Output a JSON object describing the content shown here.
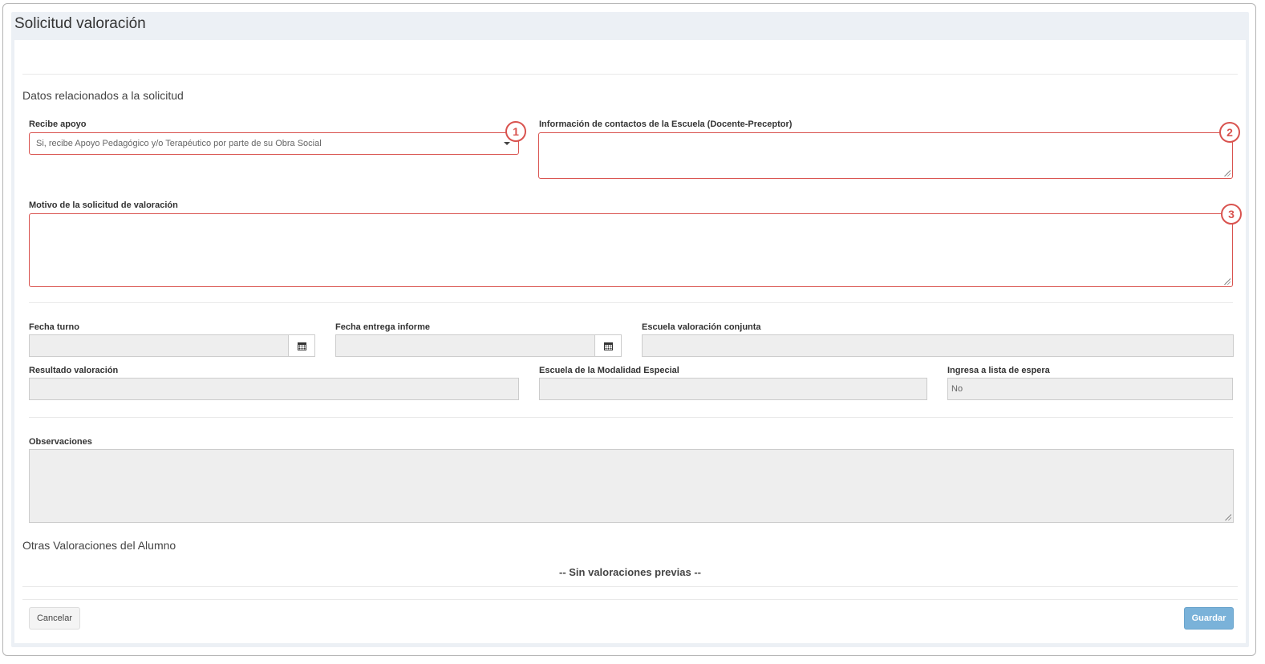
{
  "panel": {
    "title": "Solicitud valoración"
  },
  "section1": {
    "title": "Datos relacionados a la solicitud"
  },
  "fields": {
    "recibe_apoyo": {
      "label": "Recibe apoyo",
      "value": "Si, recibe Apoyo Pedagógico y/o Terapéutico por parte de su Obra Social"
    },
    "contactos": {
      "label": "Información de contactos de la Escuela (Docente-Preceptor)",
      "value": ""
    },
    "motivo": {
      "label": "Motivo de la solicitud de valoración",
      "value": ""
    },
    "fecha_turno": {
      "label": "Fecha turno",
      "value": ""
    },
    "fecha_entrega": {
      "label": "Fecha entrega informe",
      "value": ""
    },
    "escuela_conjunta": {
      "label": "Escuela valoración conjunta",
      "value": ""
    },
    "resultado": {
      "label": "Resultado valoración",
      "value": ""
    },
    "escuela_modalidad": {
      "label": "Escuela de la Modalidad Especial",
      "value": ""
    },
    "lista_espera": {
      "label": "Ingresa a lista de espera",
      "value": "No"
    },
    "observaciones": {
      "label": "Observaciones",
      "value": ""
    }
  },
  "badges": [
    "1",
    "2",
    "3"
  ],
  "section2": {
    "title": "Otras Valoraciones del Alumno",
    "empty_text": "-- Sin valoraciones previas --"
  },
  "footer": {
    "cancel_label": "Cancelar",
    "save_label": "Guardar"
  },
  "colors": {
    "highlight": "#d9534f",
    "save_button": "#7ab2d9"
  },
  "icons": {
    "date_picker": "calendar-icon",
    "select": "caret-down-icon"
  }
}
